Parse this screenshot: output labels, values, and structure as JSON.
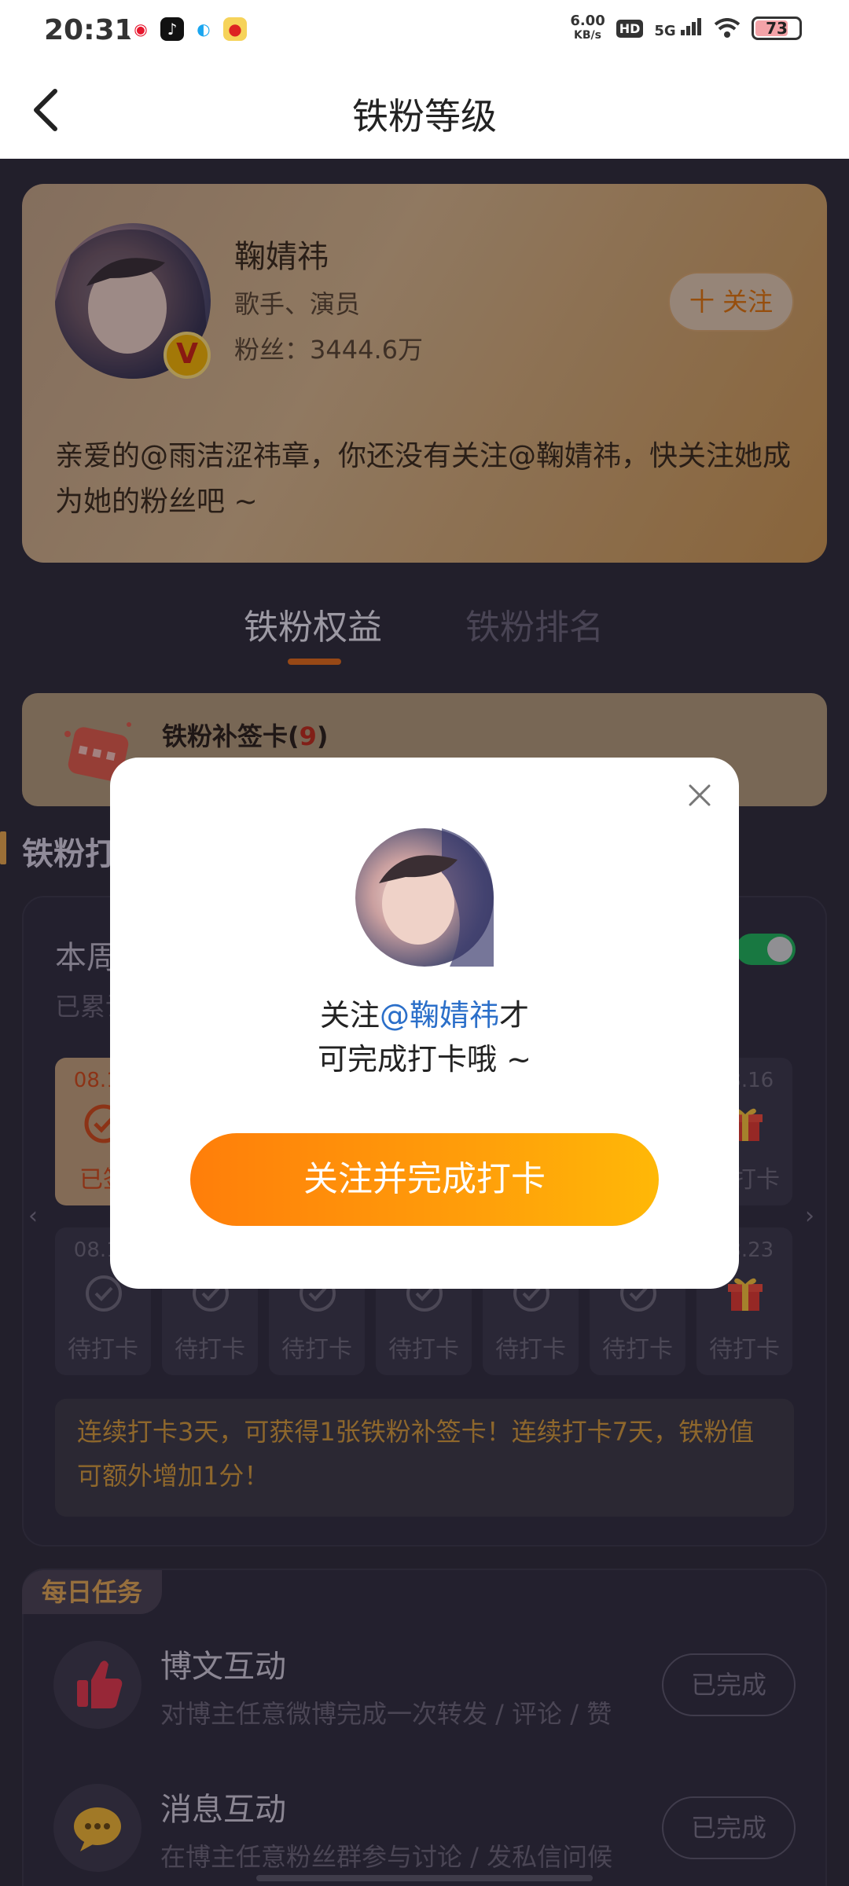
{
  "status_bar": {
    "time": "20:31",
    "speed_value": "6.00",
    "speed_unit": "KB/s",
    "hd_badge": "HD",
    "network": "5G",
    "battery": "73",
    "app_icons": [
      "weibo-icon",
      "tiktok-icon",
      "qq-icon",
      "game-icon"
    ]
  },
  "header": {
    "title": "铁粉等级"
  },
  "profile": {
    "name": "鞠婧祎",
    "role": "歌手、演员",
    "fans": "粉丝：3444.6万",
    "follow_label": "十 关注",
    "verified_badge": "V",
    "message": "亲爱的@雨洁涩祎章，你还没有关注@鞠婧祎，快关注她成为她的粉丝吧 ~"
  },
  "tabs": [
    {
      "label": "铁粉权益",
      "active": true
    },
    {
      "label": "铁粉排名",
      "active": false
    }
  ],
  "supplement_card": {
    "title": "铁粉补签卡(",
    "count": "9",
    "close": ")"
  },
  "section": {
    "title": "铁粉打卡"
  },
  "checkin": {
    "week_title": "本周打卡",
    "week_sub": "已累计打卡",
    "row1": [
      {
        "date": "08.10",
        "label": "已签",
        "done": true
      },
      {
        "date": "08.16",
        "label": "待打卡",
        "done": false,
        "gift": true
      }
    ],
    "row2": [
      {
        "date": "08.17",
        "label": "待打卡"
      },
      {
        "date": "",
        "label": "待打卡"
      },
      {
        "date": "",
        "label": "待打卡"
      },
      {
        "date": "",
        "label": "待打卡"
      },
      {
        "date": "",
        "label": "待打卡"
      },
      {
        "date": "",
        "label": "待打卡"
      },
      {
        "date": "08.23",
        "label": "待打卡",
        "gift": true
      }
    ],
    "rules": "连续打卡3天，可获得1张铁粉补签卡！连续打卡7天，铁粉值可额外增加1分！"
  },
  "tasks": {
    "tag": "每日任务",
    "items": [
      {
        "title": "博文互动",
        "sub": "对博主任意微博完成一次转发 / 评论 / 赞",
        "button": "已完成",
        "icon": "thumbs-up-icon"
      },
      {
        "title": "消息互动",
        "sub": "在博主任意粉丝群参与讨论 / 发私信问候",
        "button": "已完成",
        "icon": "chat-bubble-icon"
      }
    ]
  },
  "modal": {
    "line1_prefix": "关注",
    "mention": "@鞠婧祎",
    "line1_suffix": "才",
    "line2": "可完成打卡哦 ~",
    "button": "关注并完成打卡"
  },
  "colors": {
    "accent_orange": "#ff8a0a",
    "mention_blue": "#2b6fc9",
    "toggle_green": "#1fb45a",
    "background": "#2e2b38"
  }
}
